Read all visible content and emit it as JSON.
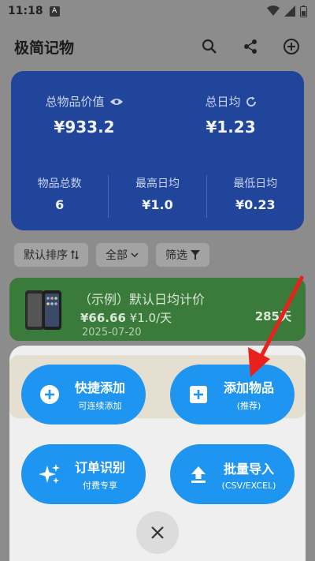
{
  "status_bar": {
    "time": "11:18",
    "badge": "A"
  },
  "app": {
    "title": "极简记物",
    "icons": [
      "search-icon",
      "share-icon",
      "add-circle-icon"
    ]
  },
  "summary": {
    "total_value_label": "总物品价值",
    "total_value": "¥933.2",
    "total_daily_label": "总日均",
    "total_daily": "¥1.23",
    "count_label": "物品总数",
    "count": "6",
    "max_daily_label": "最高日均",
    "max_daily": "¥1.0",
    "min_daily_label": "最低日均",
    "min_daily": "¥0.23"
  },
  "filters": {
    "sort": "默认排序",
    "category": "全部",
    "filter": "筛选"
  },
  "item": {
    "title": "（示例）默认日均计价",
    "price": "¥66.66",
    "daily": "¥1.0/天",
    "date": "2025-07-20",
    "days": "285天"
  },
  "actions": {
    "quick_add": {
      "label": "快捷添加",
      "sub": "可连续添加"
    },
    "add_item": {
      "label": "添加物品",
      "sub": "(推荐)"
    },
    "order_ocr": {
      "label": "订单识别",
      "sub": "付费专享"
    },
    "batch_import": {
      "label": "批量导入",
      "sub": "(CSV/EXCEL)"
    }
  },
  "colors": {
    "accent": "#1f95f2",
    "card": "#20459a",
    "item": "#3a7a3a",
    "arrow": "#e8211c"
  }
}
